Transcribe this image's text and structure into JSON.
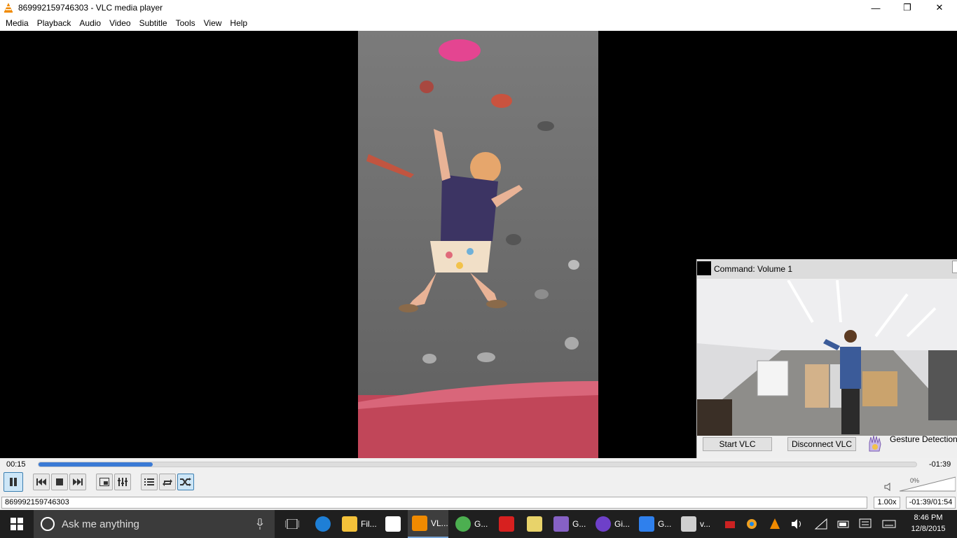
{
  "window": {
    "title": "869992159746303 - VLC media player",
    "controls": {
      "minimize": "—",
      "maximize": "❐",
      "close": "✕"
    }
  },
  "menu": [
    "Media",
    "Playback",
    "Audio",
    "Video",
    "Subtitle",
    "Tools",
    "View",
    "Help"
  ],
  "overlay": {
    "command_text": "Command: Volume 1",
    "start_button": "Start VLC",
    "disconnect_button": "Disconnect VLC",
    "gesture_label": "Gesture Detection:"
  },
  "player": {
    "elapsed": "00:15",
    "remaining": "-01:39",
    "progress_fraction": 0.13,
    "volume_percent": "0%",
    "buttons": [
      "pause-icon",
      "previous-icon",
      "stop-icon",
      "next-icon",
      "fullscreen-icon",
      "extended-settings-icon",
      "playlist-icon",
      "loop-icon",
      "shuffle-icon"
    ]
  },
  "status": {
    "file": "869992159746303",
    "rate": "1.00x",
    "time": "-01:39/01:54"
  },
  "taskbar": {
    "search_placeholder": "Ask me anything",
    "items": [
      {
        "label": "Fil...",
        "icon": "file-explorer-icon",
        "color": "#f3c13a"
      },
      {
        "label": "",
        "icon": "store-icon",
        "color": "#ffffff"
      },
      {
        "label": "VL...",
        "icon": "vlc-icon",
        "color": "#f08a00"
      },
      {
        "label": "G...",
        "icon": "chrome-icon",
        "color": "#4caf50"
      },
      {
        "label": "",
        "icon": "acrobat-icon",
        "color": "#d7201f"
      },
      {
        "label": "",
        "icon": "folder-icon",
        "color": "#e8d36a"
      },
      {
        "label": "G...",
        "icon": "visual-studio-icon",
        "color": "#8661c5"
      },
      {
        "label": "Gi...",
        "icon": "github-icon",
        "color": "#6e40c9"
      },
      {
        "label": "G...",
        "icon": "window-app-icon",
        "color": "#2f80ed"
      },
      {
        "label": "v...",
        "icon": "paint-icon",
        "color": "#cfcfcf"
      }
    ],
    "clock_time": "8:46 PM",
    "clock_date": "12/8/2015"
  }
}
